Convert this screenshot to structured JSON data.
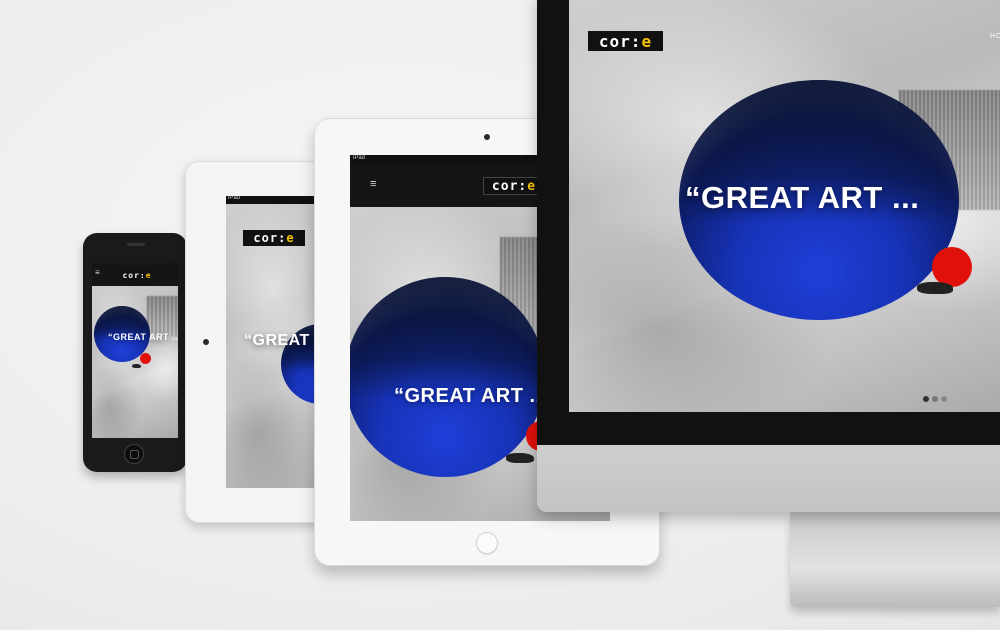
{
  "brand": {
    "logo_main": "cor:",
    "logo_accent": "e"
  },
  "hero": {
    "headline": "“GREAT ART ...",
    "headline_short": "“GREAT ART ..."
  },
  "desktop_nav": {
    "first_letters": "HO"
  },
  "tablet": {
    "status_label": "iPad"
  },
  "menu_icon": "≡",
  "slider": {
    "active_index": 0,
    "dots": 3
  },
  "colors": {
    "accent_blue": "#1733b8",
    "accent_red": "#e0100a",
    "logo_yellow": "#f5c400"
  }
}
